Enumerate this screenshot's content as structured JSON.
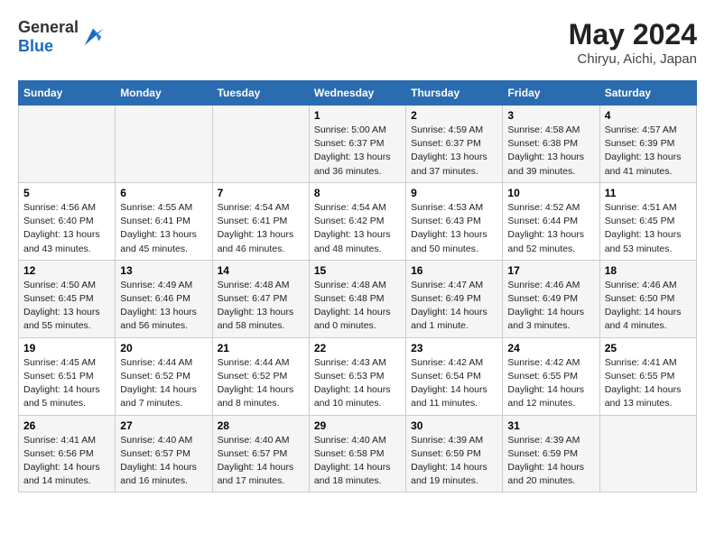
{
  "header": {
    "logo_general": "General",
    "logo_blue": "Blue",
    "month_year": "May 2024",
    "location": "Chiryu, Aichi, Japan"
  },
  "weekdays": [
    "Sunday",
    "Monday",
    "Tuesday",
    "Wednesday",
    "Thursday",
    "Friday",
    "Saturday"
  ],
  "weeks": [
    [
      {
        "day": "",
        "info": ""
      },
      {
        "day": "",
        "info": ""
      },
      {
        "day": "",
        "info": ""
      },
      {
        "day": "1",
        "info": "Sunrise: 5:00 AM\nSunset: 6:37 PM\nDaylight: 13 hours\nand 36 minutes."
      },
      {
        "day": "2",
        "info": "Sunrise: 4:59 AM\nSunset: 6:37 PM\nDaylight: 13 hours\nand 37 minutes."
      },
      {
        "day": "3",
        "info": "Sunrise: 4:58 AM\nSunset: 6:38 PM\nDaylight: 13 hours\nand 39 minutes."
      },
      {
        "day": "4",
        "info": "Sunrise: 4:57 AM\nSunset: 6:39 PM\nDaylight: 13 hours\nand 41 minutes."
      }
    ],
    [
      {
        "day": "5",
        "info": "Sunrise: 4:56 AM\nSunset: 6:40 PM\nDaylight: 13 hours\nand 43 minutes."
      },
      {
        "day": "6",
        "info": "Sunrise: 4:55 AM\nSunset: 6:41 PM\nDaylight: 13 hours\nand 45 minutes."
      },
      {
        "day": "7",
        "info": "Sunrise: 4:54 AM\nSunset: 6:41 PM\nDaylight: 13 hours\nand 46 minutes."
      },
      {
        "day": "8",
        "info": "Sunrise: 4:54 AM\nSunset: 6:42 PM\nDaylight: 13 hours\nand 48 minutes."
      },
      {
        "day": "9",
        "info": "Sunrise: 4:53 AM\nSunset: 6:43 PM\nDaylight: 13 hours\nand 50 minutes."
      },
      {
        "day": "10",
        "info": "Sunrise: 4:52 AM\nSunset: 6:44 PM\nDaylight: 13 hours\nand 52 minutes."
      },
      {
        "day": "11",
        "info": "Sunrise: 4:51 AM\nSunset: 6:45 PM\nDaylight: 13 hours\nand 53 minutes."
      }
    ],
    [
      {
        "day": "12",
        "info": "Sunrise: 4:50 AM\nSunset: 6:45 PM\nDaylight: 13 hours\nand 55 minutes."
      },
      {
        "day": "13",
        "info": "Sunrise: 4:49 AM\nSunset: 6:46 PM\nDaylight: 13 hours\nand 56 minutes."
      },
      {
        "day": "14",
        "info": "Sunrise: 4:48 AM\nSunset: 6:47 PM\nDaylight: 13 hours\nand 58 minutes."
      },
      {
        "day": "15",
        "info": "Sunrise: 4:48 AM\nSunset: 6:48 PM\nDaylight: 14 hours\nand 0 minutes."
      },
      {
        "day": "16",
        "info": "Sunrise: 4:47 AM\nSunset: 6:49 PM\nDaylight: 14 hours\nand 1 minute."
      },
      {
        "day": "17",
        "info": "Sunrise: 4:46 AM\nSunset: 6:49 PM\nDaylight: 14 hours\nand 3 minutes."
      },
      {
        "day": "18",
        "info": "Sunrise: 4:46 AM\nSunset: 6:50 PM\nDaylight: 14 hours\nand 4 minutes."
      }
    ],
    [
      {
        "day": "19",
        "info": "Sunrise: 4:45 AM\nSunset: 6:51 PM\nDaylight: 14 hours\nand 5 minutes."
      },
      {
        "day": "20",
        "info": "Sunrise: 4:44 AM\nSunset: 6:52 PM\nDaylight: 14 hours\nand 7 minutes."
      },
      {
        "day": "21",
        "info": "Sunrise: 4:44 AM\nSunset: 6:52 PM\nDaylight: 14 hours\nand 8 minutes."
      },
      {
        "day": "22",
        "info": "Sunrise: 4:43 AM\nSunset: 6:53 PM\nDaylight: 14 hours\nand 10 minutes."
      },
      {
        "day": "23",
        "info": "Sunrise: 4:42 AM\nSunset: 6:54 PM\nDaylight: 14 hours\nand 11 minutes."
      },
      {
        "day": "24",
        "info": "Sunrise: 4:42 AM\nSunset: 6:55 PM\nDaylight: 14 hours\nand 12 minutes."
      },
      {
        "day": "25",
        "info": "Sunrise: 4:41 AM\nSunset: 6:55 PM\nDaylight: 14 hours\nand 13 minutes."
      }
    ],
    [
      {
        "day": "26",
        "info": "Sunrise: 4:41 AM\nSunset: 6:56 PM\nDaylight: 14 hours\nand 14 minutes."
      },
      {
        "day": "27",
        "info": "Sunrise: 4:40 AM\nSunset: 6:57 PM\nDaylight: 14 hours\nand 16 minutes."
      },
      {
        "day": "28",
        "info": "Sunrise: 4:40 AM\nSunset: 6:57 PM\nDaylight: 14 hours\nand 17 minutes."
      },
      {
        "day": "29",
        "info": "Sunrise: 4:40 AM\nSunset: 6:58 PM\nDaylight: 14 hours\nand 18 minutes."
      },
      {
        "day": "30",
        "info": "Sunrise: 4:39 AM\nSunset: 6:59 PM\nDaylight: 14 hours\nand 19 minutes."
      },
      {
        "day": "31",
        "info": "Sunrise: 4:39 AM\nSunset: 6:59 PM\nDaylight: 14 hours\nand 20 minutes."
      },
      {
        "day": "",
        "info": ""
      }
    ]
  ]
}
